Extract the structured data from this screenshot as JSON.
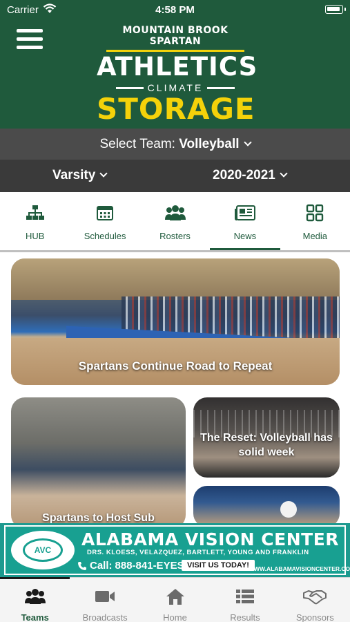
{
  "status_bar": {
    "carrier": "Carrier",
    "time": "4:58 PM"
  },
  "header": {
    "logo_top": "MOUNTAIN BROOK SPARTAN",
    "logo_mid": "ATHLETICS",
    "logo_climate": "CLIMATE",
    "logo_bottom": "STORAGE"
  },
  "team_select": {
    "label": "Select Team:",
    "value": "Volleyball"
  },
  "season": {
    "level": "Varsity",
    "year": "2020-2021"
  },
  "subnav": {
    "items": [
      {
        "label": "HUB",
        "icon": "org-chart-icon"
      },
      {
        "label": "Schedules",
        "icon": "calendar-icon"
      },
      {
        "label": "Rosters",
        "icon": "group-icon"
      },
      {
        "label": "News",
        "icon": "newspaper-icon"
      },
      {
        "label": "Media",
        "icon": "grid-icon"
      }
    ],
    "active": "News"
  },
  "news": {
    "featured": "Spartans Continue Road to Repeat",
    "left": "Spartans to Host Sub",
    "right_top": "The Reset: Volleyball has solid week"
  },
  "ad": {
    "title": "ALABAMA VISION CENTER",
    "logo_text": "AVC",
    "doctors": "DRS. KLOESS, VELAZQUEZ, BARTLETT, YOUNG AND FRANKLIN",
    "call_label": "Call:",
    "phone": "888-841-EYES",
    "button": "VISIT US TODAY!",
    "url": "WWW.ALABAMAVISIONCENTER.COM",
    "color": "#18a091"
  },
  "tabbar": {
    "items": [
      {
        "label": "Teams",
        "icon": "teams-icon"
      },
      {
        "label": "Broadcasts",
        "icon": "video-camera-icon"
      },
      {
        "label": "Home",
        "icon": "home-icon"
      },
      {
        "label": "Results",
        "icon": "list-icon"
      },
      {
        "label": "Sponsors",
        "icon": "handshake-icon"
      }
    ],
    "active": "Teams"
  },
  "colors": {
    "brand_green": "#1f5a3c",
    "accent_yellow": "#f4d20a"
  }
}
